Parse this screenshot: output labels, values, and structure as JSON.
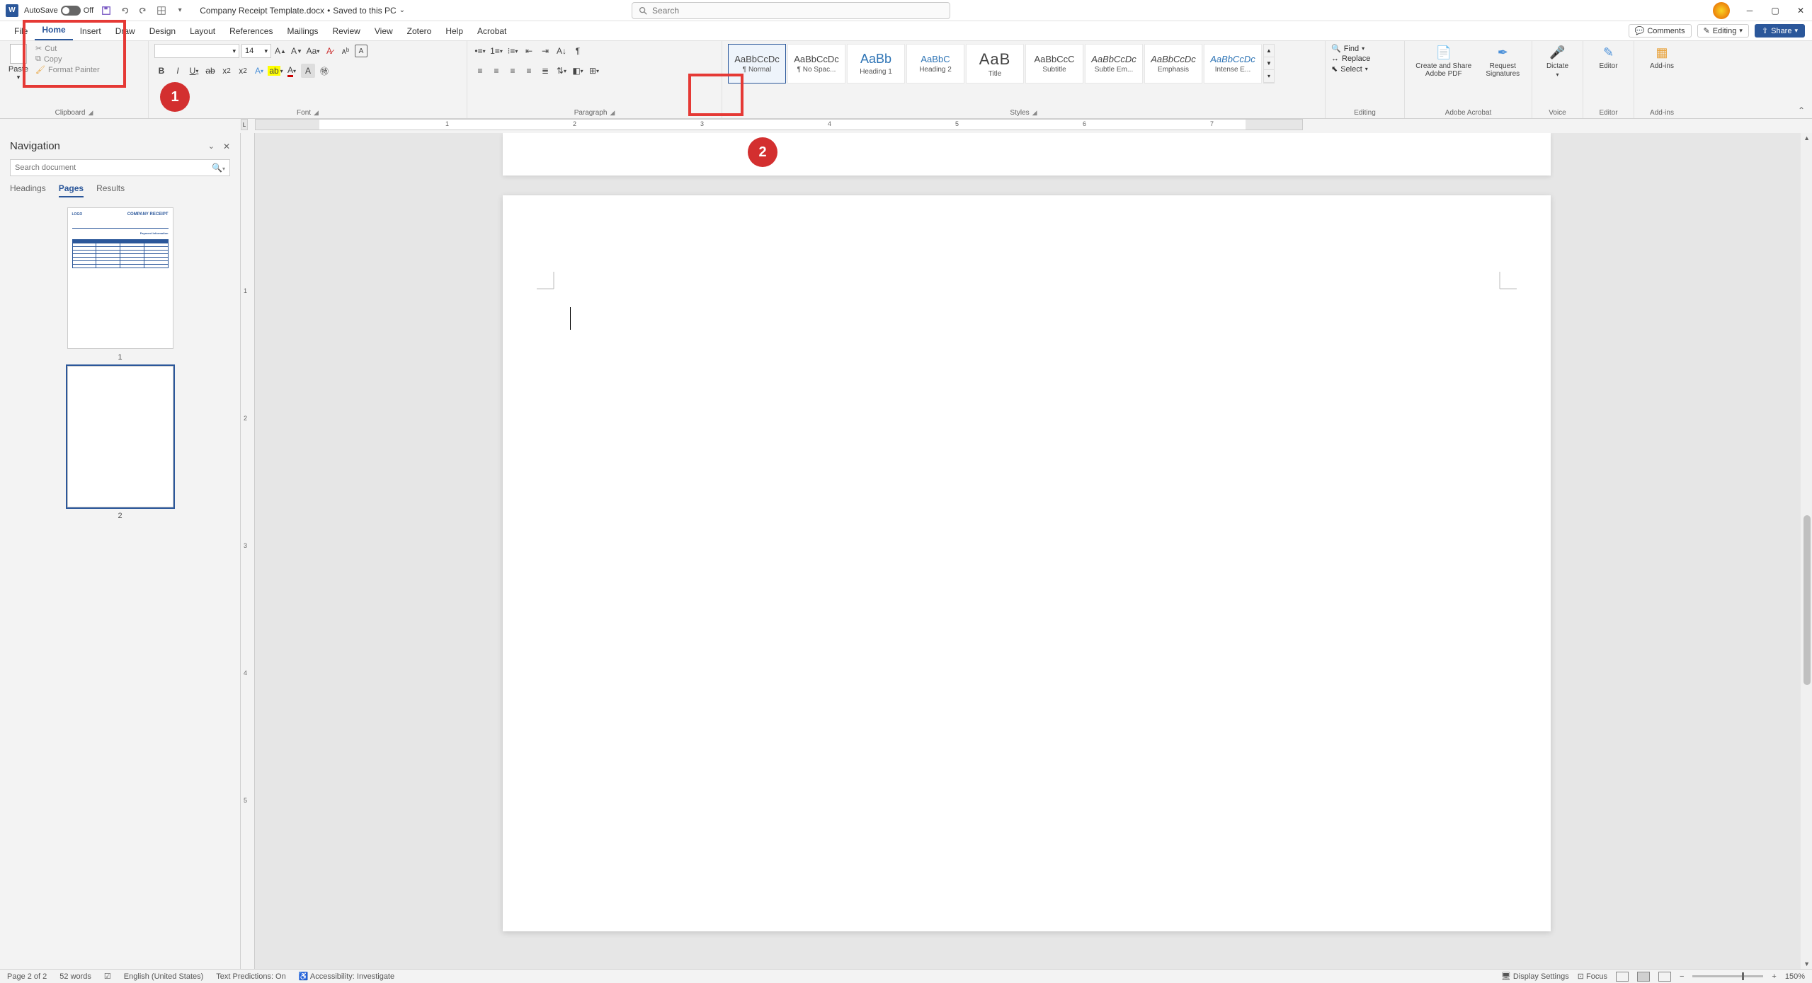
{
  "titlebar": {
    "autosave_label": "AutoSave",
    "autosave_state": "Off",
    "doc_name": "Company Receipt Template.docx",
    "save_status": "Saved to this PC",
    "search_placeholder": "Search"
  },
  "tabs": {
    "file": "File",
    "home": "Home",
    "insert": "Insert",
    "draw": "Draw",
    "design": "Design",
    "layout": "Layout",
    "references": "References",
    "mailings": "Mailings",
    "review": "Review",
    "view": "View",
    "zotero": "Zotero",
    "help": "Help",
    "acrobat": "Acrobat",
    "comments": "Comments",
    "editing": "Editing",
    "share": "Share"
  },
  "ribbon": {
    "clipboard": {
      "label": "Clipboard",
      "paste": "Paste",
      "cut": "Cut",
      "copy": "Copy",
      "format_painter": "Format Painter"
    },
    "font": {
      "label": "Font",
      "name": "",
      "size": "14"
    },
    "paragraph": {
      "label": "Paragraph"
    },
    "styles": {
      "label": "Styles",
      "items": [
        {
          "preview": "AaBbCcDc",
          "name": "¶ Normal",
          "cls": ""
        },
        {
          "preview": "AaBbCcDc",
          "name": "¶ No Spac...",
          "cls": ""
        },
        {
          "preview": "AaBb",
          "name": "Heading 1",
          "cls": "blue big"
        },
        {
          "preview": "AaBbC",
          "name": "Heading 2",
          "cls": "blue"
        },
        {
          "preview": "AaB",
          "name": "Title",
          "cls": "title"
        },
        {
          "preview": "AaBbCcC",
          "name": "Subtitle",
          "cls": ""
        },
        {
          "preview": "AaBbCcDc",
          "name": "Subtle Em...",
          "cls": "italic"
        },
        {
          "preview": "AaBbCcDc",
          "name": "Emphasis",
          "cls": "italic"
        },
        {
          "preview": "AaBbCcDc",
          "name": "Intense E...",
          "cls": "blue italic"
        }
      ]
    },
    "editing": {
      "label": "Editing",
      "find": "Find",
      "replace": "Replace",
      "select": "Select"
    },
    "acrobat": {
      "label": "Adobe Acrobat",
      "create": "Create and Share Adobe PDF",
      "request": "Request Signatures"
    },
    "voice": {
      "label": "Voice",
      "dictate": "Dictate"
    },
    "editor": {
      "label": "Editor",
      "editor": "Editor"
    },
    "addins": {
      "label": "Add-ins",
      "addins": "Add-ins"
    }
  },
  "ruler": {
    "nums": [
      "1",
      "2",
      "3",
      "4",
      "5",
      "6",
      "7"
    ]
  },
  "nav": {
    "title": "Navigation",
    "search_placeholder": "Search document",
    "tabs": {
      "headings": "Headings",
      "pages": "Pages",
      "results": "Results"
    },
    "page1_label": "1",
    "page2_label": "2",
    "thumb1": {
      "logo": "LOGO",
      "title": "COMPANY RECEIPT",
      "section": "Payment Information"
    }
  },
  "annotations": {
    "one": "1",
    "two": "2"
  },
  "status": {
    "page": "Page 2 of 2",
    "words": "52 words",
    "lang": "English (United States)",
    "predictions": "Text Predictions: On",
    "accessibility": "Accessibility: Investigate",
    "display": "Display Settings",
    "focus": "Focus",
    "zoom": "150%"
  }
}
